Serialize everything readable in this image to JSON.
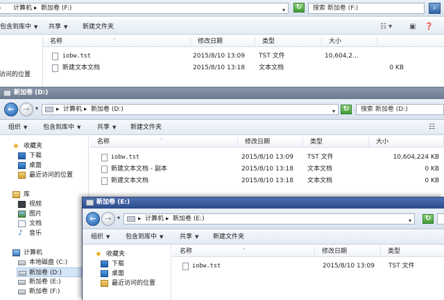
{
  "w1": {
    "address": [
      "计算机",
      "新加卷 (F:)"
    ],
    "search_placeholder": "搜索 新加卷 (F:)",
    "toolbar": {
      "include": "包含到库中",
      "share": "共享",
      "new_folder": "新建文件夹"
    },
    "nav_partial": "访问的位置",
    "columns": [
      "名称",
      "修改日期",
      "类型",
      "大小"
    ],
    "files": [
      {
        "name": "iobw.tst",
        "date": "2015/8/10 13:09",
        "type": "TST 文件",
        "size": "10,604,2..."
      },
      {
        "name": "新建文本文档",
        "date": "2015/8/10 13:18",
        "type": "文本文档",
        "size": "0 KB"
      }
    ]
  },
  "w2": {
    "title": "新加卷 (D:)",
    "address": [
      "计算机",
      "新加卷 (D:)"
    ],
    "search_placeholder": "搜索 新加卷 (D:)",
    "toolbar": {
      "organize": "组织",
      "include": "包含到库中",
      "share": "共享",
      "new_folder": "新建文件夹"
    },
    "nav": {
      "favorites": "收藏夹",
      "downloads": "下载",
      "desktop": "桌面",
      "recent": "最近访问的位置",
      "libraries": "库",
      "videos": "视频",
      "pictures": "图片",
      "documents": "文档",
      "music": "音乐",
      "computer": "计算机",
      "local_disk": "本地磁盘 (C:)",
      "drive_d": "新加卷 (D:)",
      "drive_e": "新加卷 (E:)",
      "drive_f": "新加卷 (F:)"
    },
    "columns": [
      "名称",
      "修改日期",
      "类型",
      "大小"
    ],
    "files": [
      {
        "name": "iobw.tst",
        "date": "2015/8/10 13:09",
        "type": "TST 文件",
        "size": "10,604,224 KB"
      },
      {
        "name": "新建文本文档 - 副本",
        "date": "2015/8/10 13:18",
        "type": "文本文档",
        "size": "0 KB"
      },
      {
        "name": "新建文本文档",
        "date": "2015/8/10 13:18",
        "type": "文本文档",
        "size": "0 KB"
      }
    ]
  },
  "w3": {
    "title": "新加卷 (E:)",
    "address": [
      "计算机",
      "新加卷 (E:)"
    ],
    "toolbar": {
      "organize": "组织",
      "include": "包含到库中",
      "share": "共享",
      "new_folder": "新建文件夹"
    },
    "nav": {
      "favorites": "收藏夹",
      "downloads": "下载",
      "desktop": "桌面",
      "recent": "最近访问的位置"
    },
    "columns": [
      "名称",
      "修改日期",
      "类型"
    ],
    "files": [
      {
        "name": "iobw.tst",
        "date": "2015/8/10 13:09",
        "type": "TST 文件"
      }
    ]
  },
  "colors": {
    "title_active": "#2b4b8c",
    "title_inactive": "#7d899c",
    "selection": "#d5e5f7"
  }
}
